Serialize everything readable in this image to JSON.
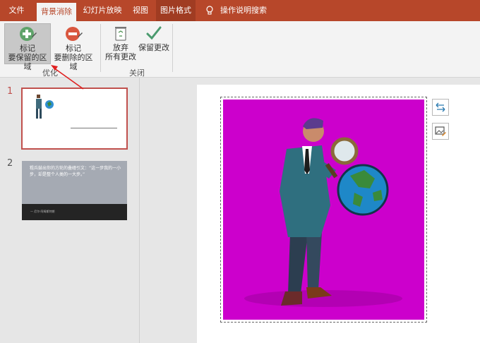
{
  "tabs": {
    "file": "文件",
    "background_removal": "背景消除",
    "slideshow": "幻灯片放映",
    "view": "视图",
    "picture_format": "图片格式",
    "tell_me": "操作说明搜索"
  },
  "ribbon": {
    "mark_keep": {
      "line1": "标记",
      "line2": "要保留的区域"
    },
    "mark_remove": {
      "line1": "标记",
      "line2": "要删除的区域"
    },
    "discard": {
      "line1": "放弃",
      "line2": "所有更改"
    },
    "keep_changes": {
      "line1": "保留更改"
    },
    "group_optimize": "优化",
    "group_close": "关闭"
  },
  "slides": [
    {
      "number": "1"
    },
    {
      "number": "2",
      "quote": "粗兵鼓出你的方轮的叠碴引文：“这一步我的一小步，却是整个人类的一大步。”",
      "author": "— 尼尔·阿姆斯特朗"
    }
  ],
  "colors": {
    "accent": "#b7472a",
    "picture_bg": "#cc00cc",
    "selected_outline": "#c0504d"
  },
  "icons": {
    "keep": "plus-circle-icon",
    "remove": "minus-circle-icon",
    "discard": "recycle-bin-icon",
    "keep_changes": "checkmark-icon",
    "tell_me": "lightbulb-icon",
    "layout": "swap-arrows-icon",
    "alt_text": "picture-edit-icon"
  }
}
